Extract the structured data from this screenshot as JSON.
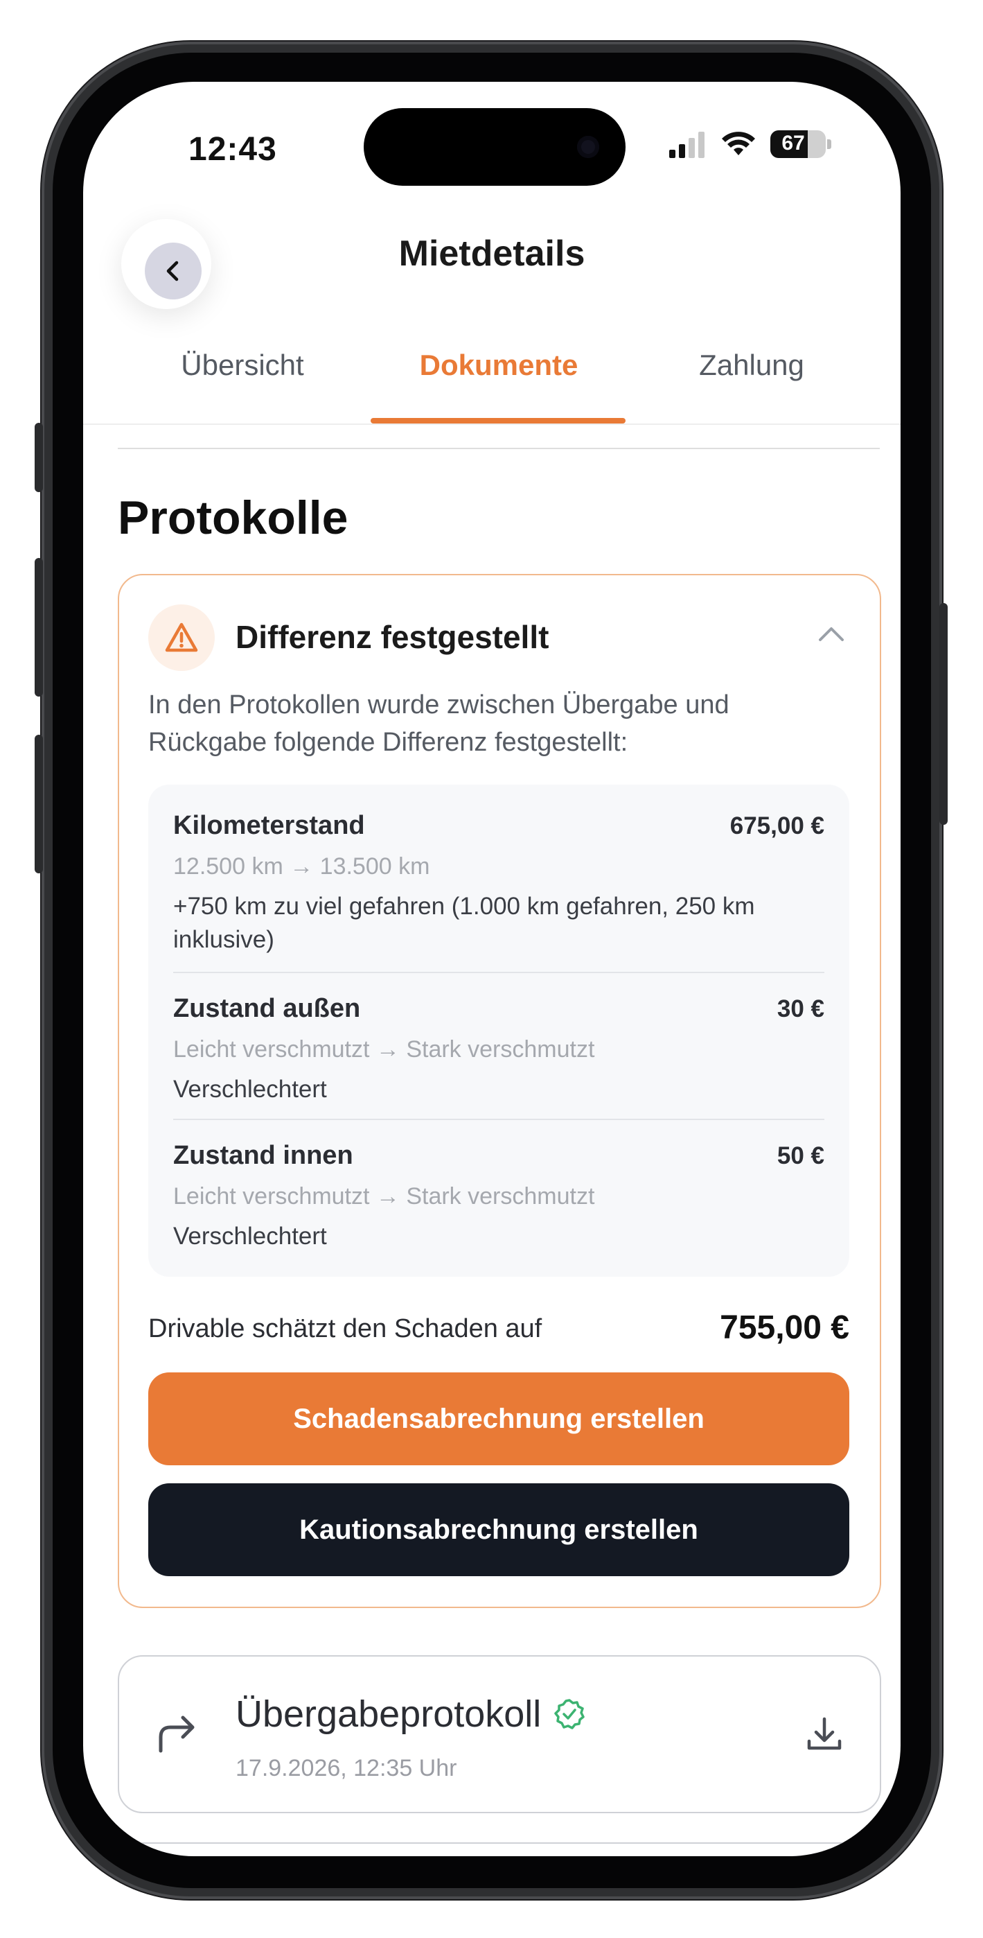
{
  "status_bar": {
    "time": "12:43",
    "battery": "67"
  },
  "header": {
    "title": "Mietdetails"
  },
  "tabs": [
    {
      "label": "Übersicht",
      "active": false
    },
    {
      "label": "Dokumente",
      "active": true
    },
    {
      "label": "Zahlung",
      "active": false
    }
  ],
  "section": {
    "title": "Protokolle"
  },
  "warning": {
    "title": "Differenz festgestellt",
    "description": "In den Protokollen wurde zwischen Übergabe und Rückgabe folgende Differenz festgestellt:",
    "items": [
      {
        "label": "Kilometerstand",
        "amount": "675,00 €",
        "change": "12.500 km → 13.500 km",
        "note": "+750 km zu viel gefahren (1.000 km gefahren, 250 km inklusive)"
      },
      {
        "label": "Zustand außen",
        "amount": "30 €",
        "change": "Leicht verschmutzt → Stark verschmutzt",
        "note": "Verschlechtert"
      },
      {
        "label": "Zustand innen",
        "amount": "50 €",
        "change": "Leicht verschmutzt → Stark verschmutzt",
        "note": "Verschlechtert"
      }
    ],
    "estimate_label": "Drivable schätzt den Schaden auf",
    "estimate_value": "755,00 €",
    "primary_button": "Schadensabrechnung erstellen",
    "secondary_button": "Kautionsabrechnung erstellen"
  },
  "protocols": [
    {
      "title": "Übergabeprotokoll",
      "date": "17.9.2026, 12:35 Uhr",
      "verified": true
    }
  ],
  "colors": {
    "accent": "#e97a36",
    "dark": "#141923",
    "success": "#3cb371",
    "warning_border": "#f2b98d"
  }
}
